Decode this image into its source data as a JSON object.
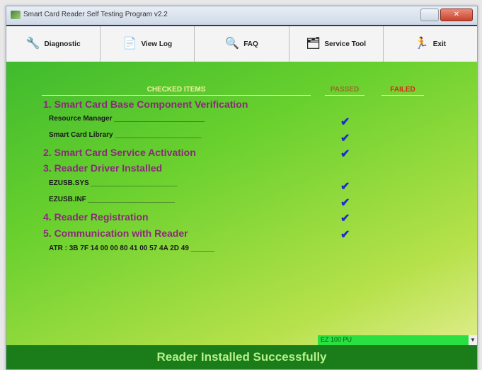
{
  "window": {
    "title": "Smart Card Reader Self Testing Program v2.2"
  },
  "toolbar": {
    "buttons": [
      {
        "label": "Diagnostic",
        "icon": "diagnostic-icon",
        "glyph": "🔧"
      },
      {
        "label": "View Log",
        "icon": "log-icon",
        "glyph": "📄"
      },
      {
        "label": "FAQ",
        "icon": "faq-icon",
        "glyph": "🔍"
      },
      {
        "label": "Service Tool",
        "icon": "service-tool-icon",
        "glyph": "🗂"
      },
      {
        "label": "Exit",
        "icon": "exit-icon",
        "glyph": "🏃"
      }
    ]
  },
  "columns": {
    "checked_items": "CHECKED ITEMS",
    "passed": "PASSED",
    "failed": "FAILED"
  },
  "rows": [
    {
      "type": "section",
      "label": "1. Smart Card Base Component Verification",
      "passed": false
    },
    {
      "type": "item",
      "label": "Resource Manager",
      "dots": "_______________________",
      "passed": true
    },
    {
      "type": "item",
      "label": "Smart Card Library",
      "dots": "______________________",
      "passed": true
    },
    {
      "type": "section",
      "label": "2. Smart Card Service Activation",
      "passed": true
    },
    {
      "type": "section",
      "label": "3. Reader Driver Installed",
      "passed": false
    },
    {
      "type": "item",
      "label": "EZUSB.SYS",
      "dots": "______________________",
      "passed": true
    },
    {
      "type": "item",
      "label": "EZUSB.INF",
      "dots": "______________________",
      "passed": true
    },
    {
      "type": "section",
      "label": "4. Reader Registration",
      "passed": true
    },
    {
      "type": "section",
      "label": "5. Communication with Reader",
      "passed": true
    },
    {
      "type": "item",
      "label": "ATR : 3B 7F 14 00 00 80 41 00 57 4A 2D 49",
      "dots": "______",
      "passed": false
    }
  ],
  "check_glyph": "✔",
  "status_select": {
    "value": "EZ 100 PU"
  },
  "footer": {
    "message": "Reader Installed Successfully"
  },
  "colors": {
    "section_text": "#8a2a7a",
    "check": "#1c2bd6",
    "footer_bg": "#1a7d1a",
    "footer_text": "#b6f08a",
    "failed_header": "#e3201b"
  }
}
